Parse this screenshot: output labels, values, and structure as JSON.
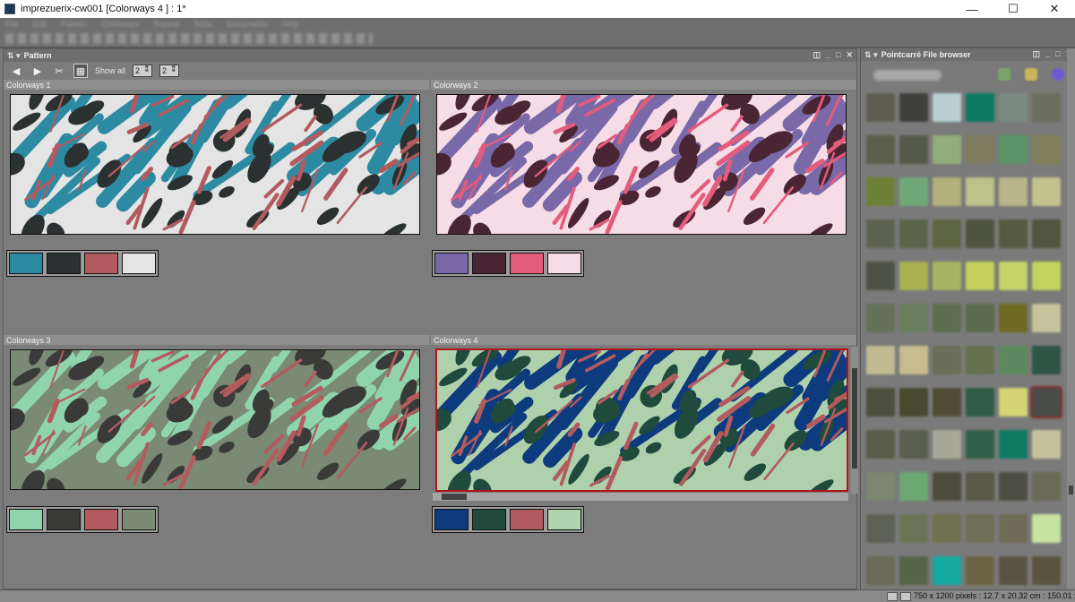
{
  "window": {
    "title": "imprezuerix-cw001 [Colorways 4 ] : 1*",
    "minimize": "—",
    "maximize": "☐",
    "close": "✕"
  },
  "menu": [
    "File",
    "Edit",
    "Pattern",
    "Colorways",
    "Repeat",
    "Tools",
    "Documents",
    "Help"
  ],
  "pattern_panel": {
    "title": "Pattern",
    "show_all_label": "Show all",
    "columns_value": "2",
    "rows_value": "2",
    "prev_icon": "◀",
    "next_icon": "▶",
    "cut_icon": "✂",
    "grid_icon": "▦"
  },
  "colorways": [
    {
      "label": "Colorways 1",
      "bg": "#e4e4e4",
      "colors": [
        "#2d8aa3",
        "#2b3030",
        "#b25b5f",
        "#e5e5e5"
      ],
      "selected": false
    },
    {
      "label": "Colorways 2",
      "bg": "#f6dce6",
      "colors": [
        "#7a69a8",
        "#4a2534",
        "#e45c7c",
        "#f6dce6"
      ],
      "selected": false
    },
    {
      "label": "Colorways 3",
      "bg": "#7a8a74",
      "colors": [
        "#90d4ae",
        "#3a3b38",
        "#b35b5e",
        "#7c8b75"
      ],
      "selected": false
    },
    {
      "label": "Colorways 4",
      "bg": "#aed1ac",
      "colors": [
        "#0d3b7d",
        "#1f4a3c",
        "#b25b5f",
        "#b0d4b0"
      ],
      "selected": true
    }
  ],
  "file_browser": {
    "title": "Pointcarré File browser",
    "tiles": [
      "#5e5e50",
      "#3f403a",
      "#b9cfd0",
      "#0c7a62",
      "#7b8a82",
      "#6b6e5e",
      "#5a5e4a",
      "#55594a",
      "#93ad7a",
      "#7d7c5e",
      "#5a9466",
      "#7f8059",
      "#6d8038",
      "#70a878",
      "#b3b07a",
      "#bcc289",
      "#b8b58a",
      "#c2c28c",
      "#5d6250",
      "#5a6448",
      "#5e6542",
      "#4f5440",
      "#565a40",
      "#525640",
      "#4e5244",
      "#a8b250",
      "#a7b464",
      "#c3d05c",
      "#c3d36a",
      "#c2d35e",
      "#647058",
      "#6b7e5e",
      "#5d6e50",
      "#5c6a4e",
      "#6e6a24",
      "#c5c49c",
      "#c2ba90",
      "#c8bb8e",
      "#6a6e58",
      "#64704e",
      "#5b8a60",
      "#2f5446",
      "#4c4e3e",
      "#48492f",
      "#4f4c36",
      "#2f5c45",
      "#d4d474",
      "#4a4c48",
      "#5a5c4a",
      "#5a5e4e",
      "#a8a898",
      "#2f6048",
      "#0f7a62",
      "#c4c29c",
      "#7c8670",
      "#6ca872",
      "#4d4a3e",
      "#5a5846",
      "#4c4e42",
      "#6b6a58",
      "#5e6256",
      "#6c7458",
      "#6e7050",
      "#6f6e56",
      "#6e6c56",
      "#c8e2a0",
      "#6a6a58",
      "#566448",
      "#15a8a0",
      "#6c6444",
      "#5a5446",
      "#5a5440"
    ]
  },
  "status": {
    "text": "750 x 1200 pixels : 12.7 x 20.32 cm : 150.01 x 150.01 dpi"
  }
}
